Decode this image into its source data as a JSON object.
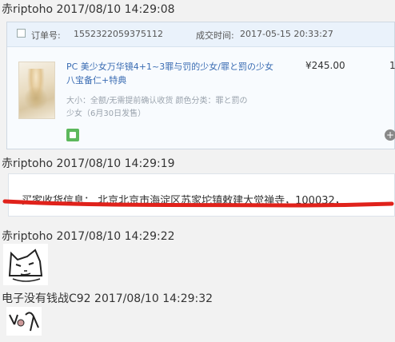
{
  "messages": [
    {
      "sender": "赤riptoho",
      "time": "2017/08/10 14:29:08"
    },
    {
      "sender": "赤riptoho",
      "time": "2017/08/10 14:29:19"
    },
    {
      "sender": "赤riptoho",
      "time": "2017/08/10 14:29:22"
    },
    {
      "sender": "电子没有钱战C92",
      "time": "2017/08/10 14:29:32"
    }
  ],
  "order": {
    "order_no_label": "订单号:",
    "order_no": "1552322059375112",
    "time_label": "成交时间:",
    "time": "2017-05-15 20:33:27",
    "title_line1": "PC 美少女万华镜4+1~3罪与罚的少女/罪と罰の少女",
    "title_line2": "八宝备仁+特典",
    "price": "¥245.00",
    "right_edge": "1",
    "attr_line1": "大小：全额/无需提前确认收货  颜色分类：罪と罰の",
    "attr_line2": "少女（6月30日发售）",
    "plus": "+"
  },
  "address": {
    "text": "买家收货信息：  北京北京市海淀区苏家坨镇敕建大觉禅寺，100032，"
  },
  "colors": {
    "link": "#3a6cb3",
    "highlight_stroke": "#e0221b"
  }
}
